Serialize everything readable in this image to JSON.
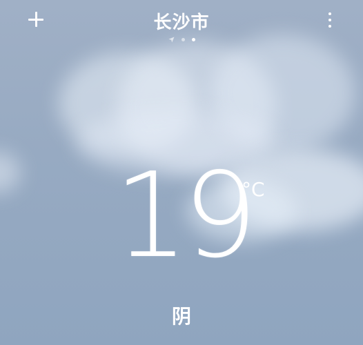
{
  "header": {
    "city": "长沙市",
    "add_icon": "plus-icon",
    "more_icon": "more-vertical-icon",
    "location_icon": "location-arrow-icon",
    "pages": {
      "total": 3,
      "active": 3
    }
  },
  "current": {
    "temperature": "19",
    "unit": "°C",
    "condition": "阴"
  },
  "colors": {
    "sky_top": "#a0b0c6",
    "sky_bottom": "#8fa5bf",
    "text": "#ffffff"
  }
}
